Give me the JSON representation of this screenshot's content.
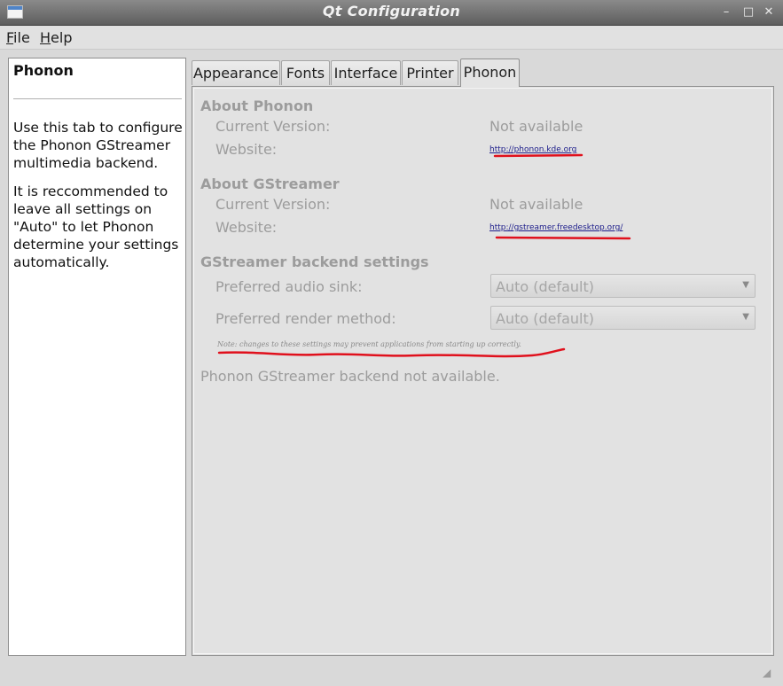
{
  "window": {
    "title": "Qt Configuration",
    "controls": {
      "minimize": "–",
      "maximize": "□",
      "close": "✕"
    }
  },
  "menubar": {
    "file": "File",
    "help": "Help"
  },
  "info_panel": {
    "title": "Phonon",
    "paragraph1": "Use this tab to configure the Phonon GStreamer multimedia backend.",
    "paragraph2": "It is reccommended to leave all settings on \"Auto\" to let Phonon determine your settings automatically."
  },
  "tabs": [
    {
      "label": "Appearance"
    },
    {
      "label": "Fonts"
    },
    {
      "label": "Interface"
    },
    {
      "label": "Printer"
    },
    {
      "label": "Phonon"
    }
  ],
  "active_tab": "Phonon",
  "phonon": {
    "about_phonon": {
      "title": "About Phonon",
      "version_label": "Current Version:",
      "version_value": "Not available",
      "website_label": "Website:",
      "website_url": "http://phonon.kde.org"
    },
    "about_gstreamer": {
      "title": "About GStreamer",
      "version_label": "Current Version:",
      "version_value": "Not available",
      "website_label": "Website:",
      "website_url": "http://gstreamer.freedesktop.org/"
    },
    "backend_settings": {
      "title": "GStreamer backend settings",
      "audio_sink_label": "Preferred audio sink:",
      "audio_sink_value": "Auto (default)",
      "render_method_label": "Preferred render method:",
      "render_method_value": "Auto (default)",
      "note": "Note: changes to these settings may prevent applications from starting up correctly."
    },
    "status": "Phonon GStreamer backend not available."
  },
  "colors": {
    "annotation_underline": "#e0101c",
    "disabled_text": "#9c9c9c",
    "link": "#1c1c8a"
  }
}
